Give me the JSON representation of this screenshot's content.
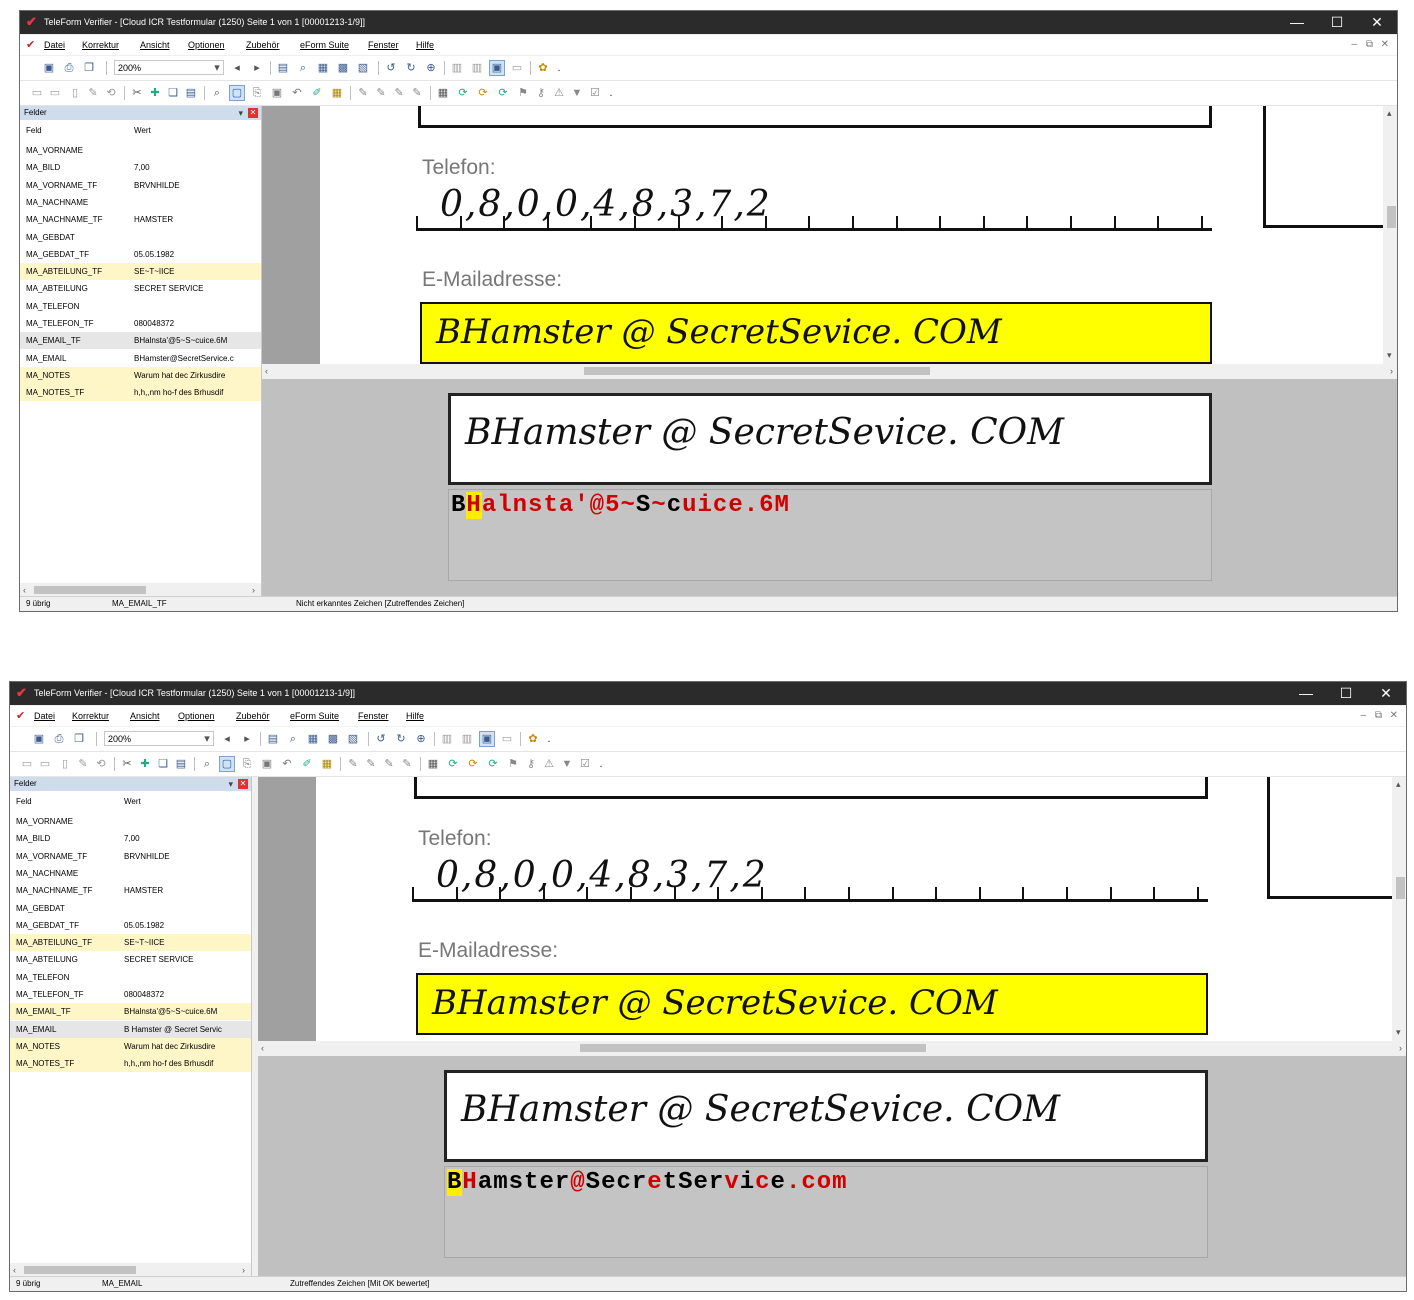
{
  "windows": [
    {
      "title": "TeleForm Verifier - [Cloud ICR Testformular (1250) Seite 1 von 1 [00001213-1/9]]",
      "menu": [
        "Datei",
        "Korrektur",
        "Ansicht",
        "Optionen",
        "Zubehör",
        "eForm Suite",
        "Fenster",
        "Hilfe"
      ],
      "zoom": "200%",
      "fields_panel_title": "Felder",
      "col_field": "Feld",
      "col_value": "Wert",
      "fields": [
        {
          "name": "MA_VORNAME",
          "value": ""
        },
        {
          "name": "MA_BILD",
          "value": "7,00"
        },
        {
          "name": "MA_VORNAME_TF",
          "value": "BRVNHILDE"
        },
        {
          "name": "MA_NACHNAME",
          "value": ""
        },
        {
          "name": "MA_NACHNAME_TF",
          "value": "HAMSTER"
        },
        {
          "name": "MA_GEBDAT",
          "value": ""
        },
        {
          "name": "MA_GEBDAT_TF",
          "value": "05.05.1982"
        },
        {
          "name": "MA_ABTEILUNG_TF",
          "value": "SE~T~IICE"
        },
        {
          "name": "MA_ABTEILUNG",
          "value": "SECRET SERVICE"
        },
        {
          "name": "MA_TELEFON",
          "value": ""
        },
        {
          "name": "MA_TELEFON_TF",
          "value": "080048372"
        },
        {
          "name": "MA_EMAIL_TF",
          "value": "BHalnsta'@5~S~cuice.6M"
        },
        {
          "name": "MA_EMAIL",
          "value": "BHamster@SecretService.c"
        },
        {
          "name": "MA_NOTES",
          "value": "Warum hat dec Zirkusdire"
        },
        {
          "name": "MA_NOTES_TF",
          "value": "h,h,,nm ho-f des Brhusdif"
        }
      ],
      "label_phone": "Telefon:",
      "phone_handwriting": "0,8,0,0,4,8,3,7,2",
      "label_email": "E-Mailadresse:",
      "email_handwriting": "BHamster @ SecretSevice. COM",
      "ocr_result": "BHalnsta'@5~S~cuice.6M",
      "status_left": "9 übrig",
      "status_field": "MA_EMAIL_TF",
      "status_message": "Nicht erkanntes Zeichen [Zutreffendes Zeichen]"
    },
    {
      "title": "TeleForm Verifier - [Cloud ICR Testformular (1250) Seite 1 von 1 [00001213-1/9]]",
      "menu": [
        "Datei",
        "Korrektur",
        "Ansicht",
        "Optionen",
        "Zubehör",
        "eForm Suite",
        "Fenster",
        "Hilfe"
      ],
      "zoom": "200%",
      "fields_panel_title": "Felder",
      "col_field": "Feld",
      "col_value": "Wert",
      "fields": [
        {
          "name": "MA_VORNAME",
          "value": ""
        },
        {
          "name": "MA_BILD",
          "value": "7,00"
        },
        {
          "name": "MA_VORNAME_TF",
          "value": "BRVNHILDE"
        },
        {
          "name": "MA_NACHNAME",
          "value": ""
        },
        {
          "name": "MA_NACHNAME_TF",
          "value": "HAMSTER"
        },
        {
          "name": "MA_GEBDAT",
          "value": ""
        },
        {
          "name": "MA_GEBDAT_TF",
          "value": "05.05.1982"
        },
        {
          "name": "MA_ABTEILUNG_TF",
          "value": "SE~T~IICE"
        },
        {
          "name": "MA_ABTEILUNG",
          "value": "SECRET SERVICE"
        },
        {
          "name": "MA_TELEFON",
          "value": ""
        },
        {
          "name": "MA_TELEFON_TF",
          "value": "080048372"
        },
        {
          "name": "MA_EMAIL_TF",
          "value": "BHalnsta'@5~S~cuice.6M"
        },
        {
          "name": "MA_EMAIL",
          "value": "B Hamster @ Secret Servic"
        },
        {
          "name": "MA_NOTES",
          "value": "Warum hat dec Zirkusdire"
        },
        {
          "name": "MA_NOTES_TF",
          "value": "h,h,,nm ho-f des Brhusdif"
        }
      ],
      "label_phone": "Telefon:",
      "phone_handwriting": "0,8,0,0,4,8,3,7,2",
      "label_email": "E-Mailadresse:",
      "email_handwriting": "BHamster @ SecretSevice. COM",
      "ocr_result": "BHamster@SecretService.com",
      "status_left": "9 übrig",
      "status_field": "MA_EMAIL",
      "status_message": "Zutreffendes Zeichen [Mit OK bewertet]"
    }
  ],
  "colors": {
    "highlight_yellow": "#ffff00",
    "error_red": "#d00000",
    "titlebar": "#2b2b2b",
    "row_highlight": "#fff6c8"
  }
}
